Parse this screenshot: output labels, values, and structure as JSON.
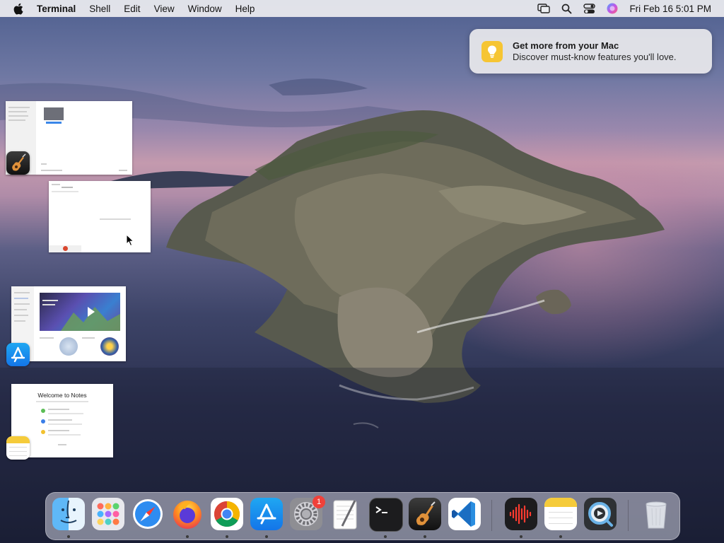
{
  "menubar": {
    "app_name": "Terminal",
    "menus": [
      "Shell",
      "Edit",
      "View",
      "Window",
      "Help"
    ],
    "status_icons": [
      "screen-mirroring-icon",
      "spotlight-icon",
      "control-center-icon",
      "siri-icon"
    ],
    "clock": "Fri Feb 16  5:01 PM"
  },
  "notification": {
    "icon": "lightbulb-icon",
    "title": "Get more from your Mac",
    "body": "Discover must-know features you'll love."
  },
  "window_thumbnails": [
    {
      "app": "GarageBand",
      "icon": "garageband-icon"
    },
    {
      "app": "Terminal",
      "icon": "terminal-window-icon"
    },
    {
      "app": "App Store",
      "icon": "app-store-icon"
    },
    {
      "app": "Notes",
      "icon": "notes-icon",
      "heading": "Welcome to Notes"
    }
  ],
  "dock": {
    "items": [
      {
        "name": "Finder",
        "icon": "finder-icon",
        "running": true
      },
      {
        "name": "Launchpad",
        "icon": "launchpad-icon",
        "running": false
      },
      {
        "name": "Safari",
        "icon": "safari-icon",
        "running": false
      },
      {
        "name": "Firefox",
        "icon": "firefox-icon",
        "running": true
      },
      {
        "name": "Chrome",
        "icon": "chrome-icon",
        "running": true
      },
      {
        "name": "App Store",
        "icon": "app-store-icon",
        "running": true
      },
      {
        "name": "System Preferences",
        "icon": "system-preferences-icon",
        "running": false,
        "badge": "1"
      },
      {
        "name": "TextEdit",
        "icon": "textedit-icon",
        "running": false
      },
      {
        "name": "Terminal",
        "icon": "terminal-icon",
        "running": true
      },
      {
        "name": "GarageBand",
        "icon": "garageband-icon",
        "running": true
      },
      {
        "name": "Visual Studio Code",
        "icon": "vscode-icon",
        "running": false
      },
      {
        "name": "Voice Memos",
        "icon": "voice-memos-icon",
        "running": true
      },
      {
        "name": "Notes",
        "icon": "notes-icon",
        "running": true
      },
      {
        "name": "QuickTime Player",
        "icon": "quicktime-icon",
        "running": false
      },
      {
        "name": "Trash",
        "icon": "trash-icon",
        "running": false
      }
    ]
  },
  "colors": {
    "menubar_bg": "#ececf0",
    "notification_icon": "#f6c533",
    "badge": "#f0413a"
  }
}
